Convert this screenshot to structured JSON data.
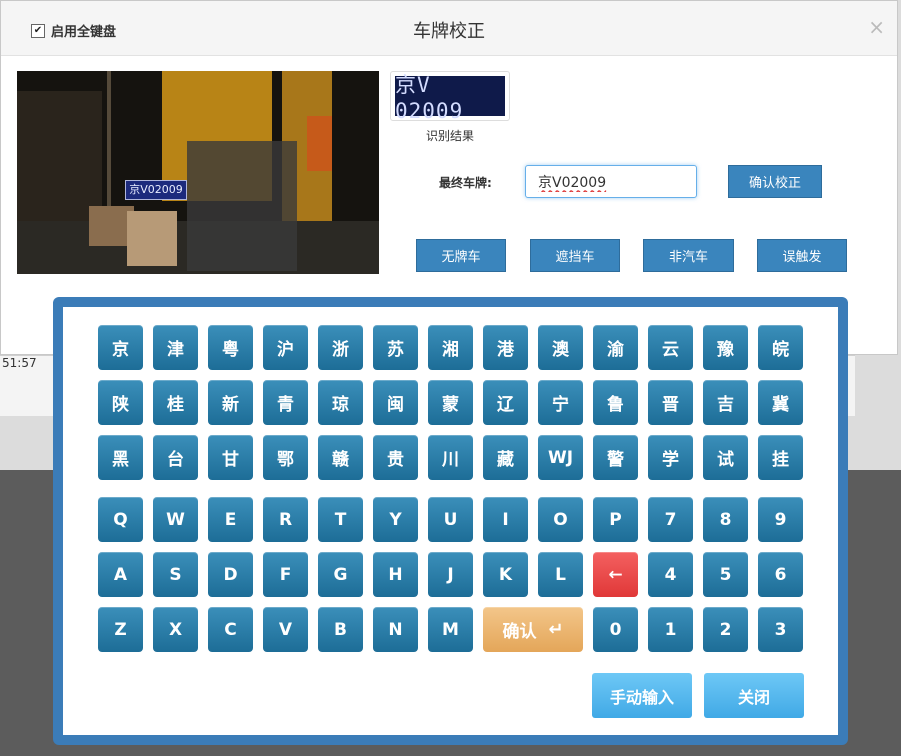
{
  "background": {
    "time_fragment": "51:57"
  },
  "dialog": {
    "title": "车牌校正",
    "full_keyboard_label": "启用全键盘",
    "full_keyboard_checked": true,
    "close_symbol": "×"
  },
  "recognition": {
    "photo_plate_text": "京V02009",
    "plate_image_text": "京V 02009",
    "result_caption": "识别结果"
  },
  "final_plate": {
    "label": "最终车牌:",
    "value": "京V02009",
    "confirm_label": "确认校正"
  },
  "actions": {
    "no_plate": "无牌车",
    "obscured": "遮挡车",
    "non_car": "非汽车",
    "false_trigger": "误触发"
  },
  "keyboard": {
    "province_rows": [
      [
        "京",
        "津",
        "粤",
        "沪",
        "浙",
        "苏",
        "湘",
        "港",
        "澳",
        "渝",
        "云",
        "豫",
        "皖"
      ],
      [
        "陕",
        "桂",
        "新",
        "青",
        "琼",
        "闽",
        "蒙",
        "辽",
        "宁",
        "鲁",
        "晋",
        "吉",
        "冀"
      ],
      [
        "黑",
        "台",
        "甘",
        "鄂",
        "赣",
        "贵",
        "川",
        "藏",
        "WJ",
        "警",
        "学",
        "试",
        "挂"
      ]
    ],
    "alpha_row1": [
      "Q",
      "W",
      "E",
      "R",
      "T",
      "Y",
      "U",
      "I",
      "O",
      "P",
      "7",
      "8",
      "9"
    ],
    "alpha_row2_left": [
      "A",
      "S",
      "D",
      "F",
      "G",
      "H",
      "J",
      "K",
      "L"
    ],
    "backspace_symbol": "←",
    "alpha_row2_right": [
      "4",
      "5",
      "6"
    ],
    "alpha_row3_left": [
      "Z",
      "X",
      "C",
      "V",
      "B",
      "N",
      "M"
    ],
    "enter_label": "确认",
    "enter_symbol": "↵",
    "alpha_row3_right": [
      "0",
      "1",
      "2",
      "3"
    ],
    "manual_input_label": "手动输入",
    "close_label": "关闭",
    "colors": {
      "key": "#2a7ea8",
      "backspace": "#ee4b4b",
      "enter": "#ebb574",
      "action": "#52b6ee",
      "frame": "#3b7cb8"
    }
  }
}
